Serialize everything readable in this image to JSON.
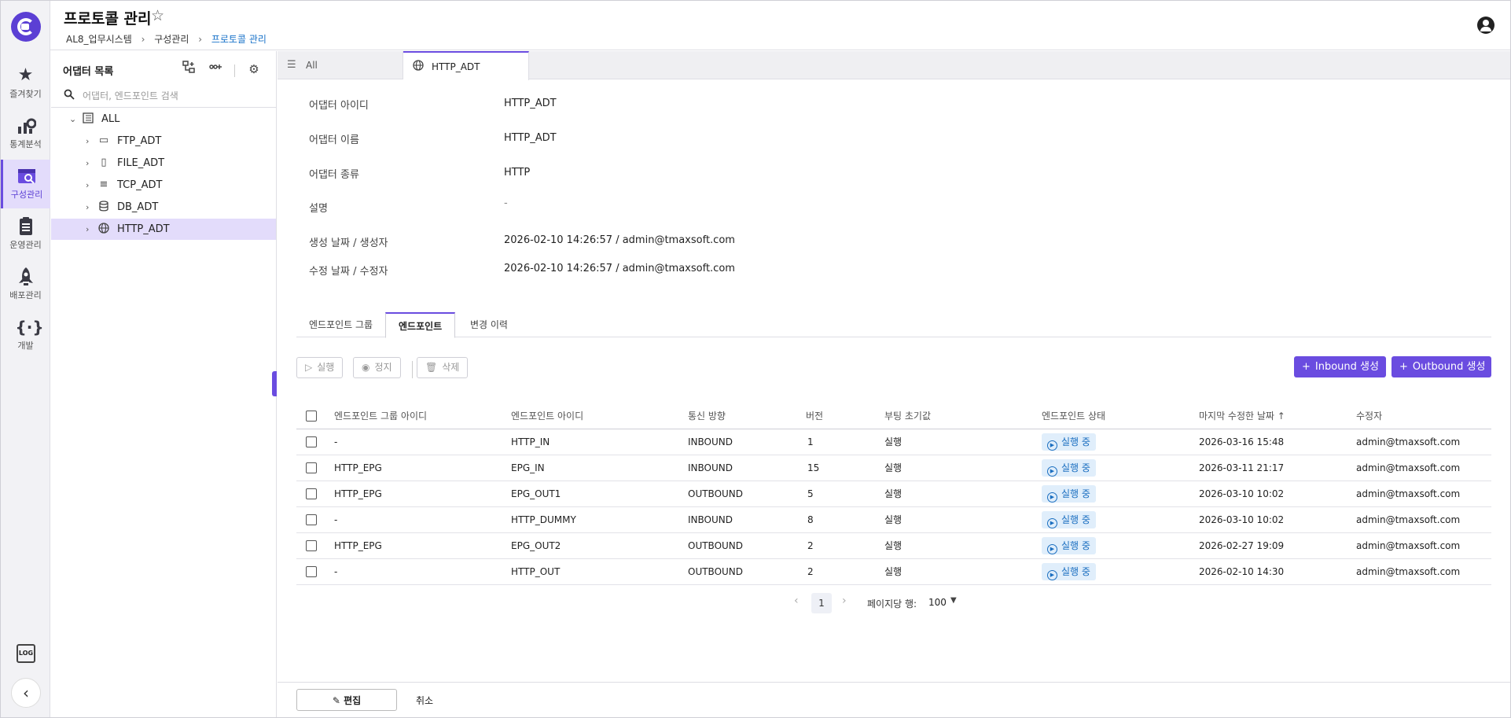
{
  "app": {
    "title": "프로토콜 관리",
    "breadcrumb": [
      "AL8_업무시스템",
      "구성관리",
      "프로토콜 관리"
    ],
    "accent_color": "#6a4ce0"
  },
  "nav": {
    "items": [
      {
        "label": "즐겨찾기",
        "icon": "star-icon"
      },
      {
        "label": "통계분석",
        "icon": "chart-icon"
      },
      {
        "label": "구성관리",
        "icon": "config-icon",
        "active": true
      },
      {
        "label": "운영관리",
        "icon": "clipboard-icon"
      },
      {
        "label": "배포관리",
        "icon": "rocket-icon"
      },
      {
        "label": "개발",
        "icon": "code-icon"
      }
    ],
    "log_label": "LOG"
  },
  "tree": {
    "title": "어댑터 목록",
    "search_placeholder": "어댑터, 엔드포인트 검색",
    "root": "ALL",
    "nodes": [
      {
        "label": "FTP_ADT",
        "icon": "ftp-icon"
      },
      {
        "label": "FILE_ADT",
        "icon": "file-icon"
      },
      {
        "label": "TCP_ADT",
        "icon": "tcp-icon"
      },
      {
        "label": "DB_ADT",
        "icon": "database-icon"
      },
      {
        "label": "HTTP_ADT",
        "icon": "globe-icon",
        "selected": true
      }
    ]
  },
  "tabs": [
    {
      "label": "All",
      "icon": "list-icon"
    },
    {
      "label": "HTTP_ADT",
      "icon": "globe-icon",
      "active": true
    }
  ],
  "details": [
    {
      "label": "어댑터 아이디",
      "value": "HTTP_ADT"
    },
    {
      "label": "어댑터 이름",
      "value": "HTTP_ADT"
    },
    {
      "label": "어댑터 종류",
      "value": "HTTP"
    },
    {
      "label": "설명",
      "value": "-"
    },
    {
      "label": "생성 날짜 / 생성자",
      "value": "2026-02-10 14:26:57 / admin@tmaxsoft.com"
    },
    {
      "label": "수정 날짜 / 수정자",
      "value": "2026-02-10 14:26:57 / admin@tmaxsoft.com"
    }
  ],
  "subtabs": [
    "엔드포인트 그룹",
    "엔드포인트",
    "변경 이력"
  ],
  "actions": {
    "run": "실행",
    "stop": "정지",
    "delete": "삭제",
    "inbound": "Inbound 생성",
    "outbound": "Outbound 생성"
  },
  "table": {
    "columns": [
      "엔드포인트 그룹 아이디",
      "엔드포인트 아이디",
      "통신 방향",
      "버전",
      "부팅 초기값",
      "엔드포인트 상태",
      "마지막 수정한 날짜 ↑",
      "수정자"
    ],
    "rows": [
      [
        "-",
        "HTTP_IN",
        "INBOUND",
        "1",
        "실행",
        "실행 중",
        "2026-03-16 15:48",
        "admin@tmaxsoft.com"
      ],
      [
        "HTTP_EPG",
        "EPG_IN",
        "INBOUND",
        "15",
        "실행",
        "실행 중",
        "2026-03-11 21:17",
        "admin@tmaxsoft.com"
      ],
      [
        "HTTP_EPG",
        "EPG_OUT1",
        "OUTBOUND",
        "5",
        "실행",
        "실행 중",
        "2026-03-10 10:02",
        "admin@tmaxsoft.com"
      ],
      [
        "-",
        "HTTP_DUMMY",
        "INBOUND",
        "8",
        "실행",
        "실행 중",
        "2026-03-10 10:02",
        "admin@tmaxsoft.com"
      ],
      [
        "HTTP_EPG",
        "EPG_OUT2",
        "OUTBOUND",
        "2",
        "실행",
        "실행 중",
        "2026-02-27 19:09",
        "admin@tmaxsoft.com"
      ],
      [
        "-",
        "HTTP_OUT",
        "OUTBOUND",
        "2",
        "실행",
        "실행 중",
        "2026-02-10 14:30",
        "admin@tmaxsoft.com"
      ]
    ]
  },
  "pagination": {
    "current_page": "1",
    "rows_per_page_label": "페이지당 행:",
    "rows_per_page": "100"
  },
  "footer": {
    "edit": "편집",
    "cancel": "취소"
  }
}
